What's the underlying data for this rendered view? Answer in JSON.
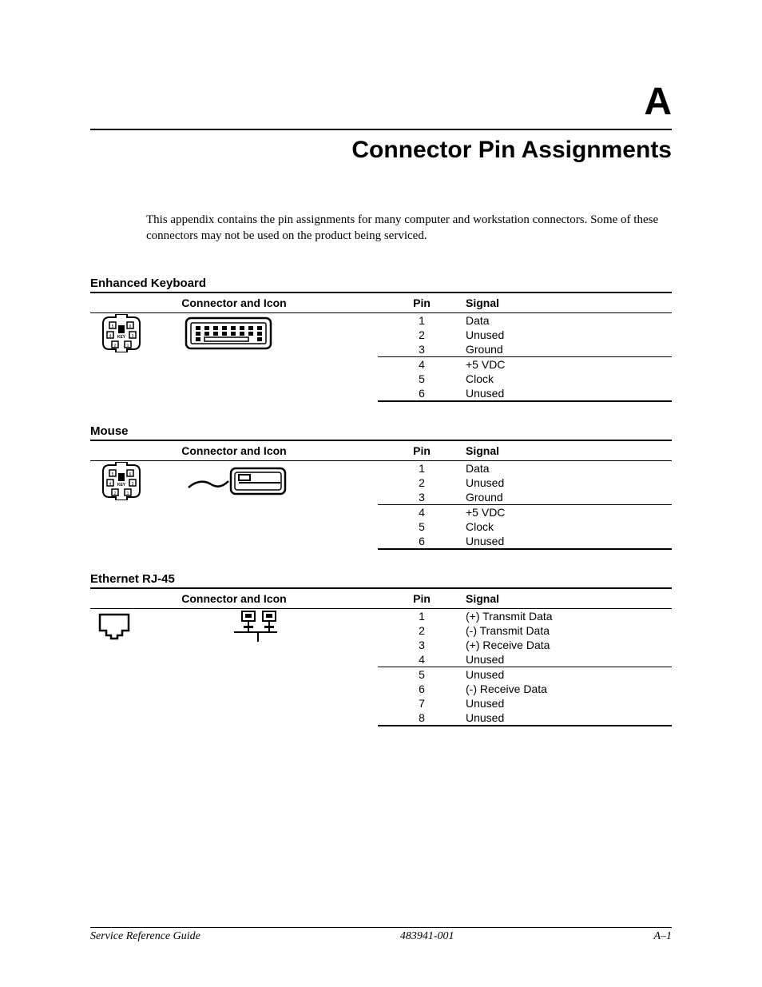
{
  "appendix_letter": "A",
  "chapter_title": "Connector Pin Assignments",
  "intro": "This appendix contains the pin assignments for many computer and workstation connectors. Some of these connectors may not be used on the product being serviced.",
  "sections": {
    "keyboard": {
      "title": "Enhanced Keyboard",
      "headers": {
        "connector": "Connector and Icon",
        "pin": "Pin",
        "signal": "Signal"
      },
      "group1": {
        "p1": {
          "pin": "1",
          "signal": "Data"
        },
        "p2": {
          "pin": "2",
          "signal": "Unused"
        },
        "p3": {
          "pin": "3",
          "signal": "Ground"
        }
      },
      "group2": {
        "p4": {
          "pin": "4",
          "signal": "+5 VDC"
        },
        "p5": {
          "pin": "5",
          "signal": "Clock"
        },
        "p6": {
          "pin": "6",
          "signal": "Unused"
        }
      }
    },
    "mouse": {
      "title": "Mouse",
      "headers": {
        "connector": "Connector and Icon",
        "pin": "Pin",
        "signal": "Signal"
      },
      "group1": {
        "p1": {
          "pin": "1",
          "signal": "Data"
        },
        "p2": {
          "pin": "2",
          "signal": "Unused"
        },
        "p3": {
          "pin": "3",
          "signal": "Ground"
        }
      },
      "group2": {
        "p4": {
          "pin": "4",
          "signal": "+5 VDC"
        },
        "p5": {
          "pin": "5",
          "signal": "Clock"
        },
        "p6": {
          "pin": "6",
          "signal": "Unused"
        }
      }
    },
    "ethernet": {
      "title": "Ethernet RJ-45",
      "headers": {
        "connector": "Connector and Icon",
        "pin": "Pin",
        "signal": "Signal"
      },
      "group1": {
        "p1": {
          "pin": "1",
          "signal": "(+) Transmit Data"
        },
        "p2": {
          "pin": "2",
          "signal": "(-) Transmit Data"
        },
        "p3": {
          "pin": "3",
          "signal": "(+) Receive Data"
        },
        "p4": {
          "pin": "4",
          "signal": "Unused"
        }
      },
      "group2": {
        "p5": {
          "pin": "5",
          "signal": "Unused"
        },
        "p6": {
          "pin": "6",
          "signal": "(-) Receive Data"
        },
        "p7": {
          "pin": "7",
          "signal": "Unused"
        },
        "p8": {
          "pin": "8",
          "signal": "Unused"
        }
      }
    }
  },
  "footer": {
    "left": "Service Reference Guide",
    "center": "483941-001",
    "right": "A–1"
  }
}
